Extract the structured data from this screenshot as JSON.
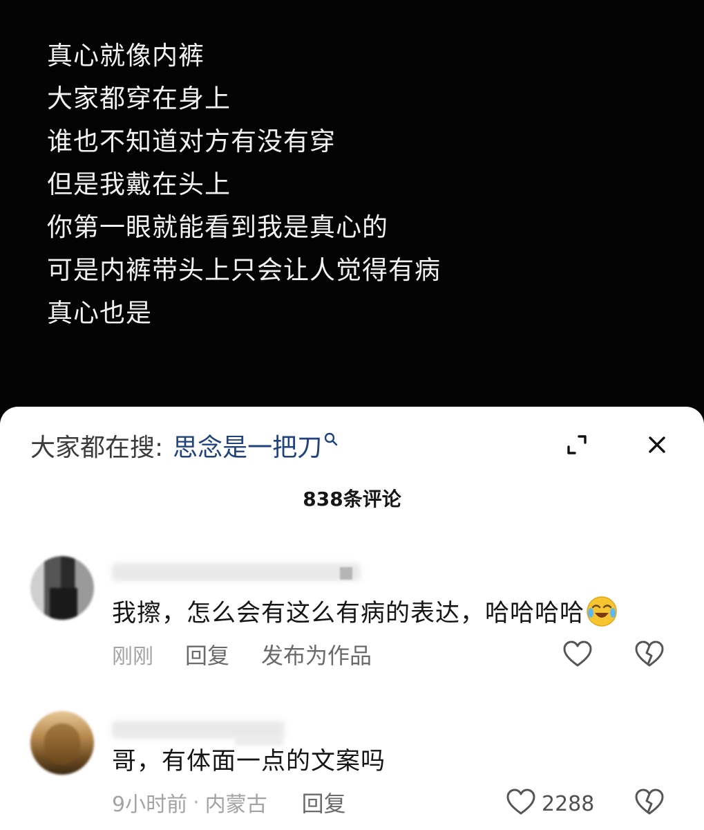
{
  "caption": {
    "lines": [
      "真心就像内裤",
      "大家都穿在身上",
      "谁也不知道对方有没有穿",
      "但是我戴在头上",
      "你第一眼就能看到我是真心的",
      "可是内裤带头上只会让人觉得有病",
      "真心也是"
    ]
  },
  "search": {
    "prefix": "大家都在搜:",
    "term": "思念是一把刀",
    "icon": "search-icon",
    "term_color": "#20437f"
  },
  "header": {
    "expand_icon": "expand-icon",
    "close_icon": "close-icon",
    "comment_count": "838条评论"
  },
  "comments": [
    {
      "text": "我擦，怎么会有这么有病的表达，哈哈哈哈",
      "emoji": "laughing-crying-emoji",
      "time": "刚刚",
      "reply_label": "回复",
      "publish_label": "发布为作品",
      "like_icon": "heart-icon",
      "dislike_icon": "broken-heart-icon"
    },
    {
      "text": "哥，有体面一点的文案吗",
      "time": "9小时前",
      "separator": "·",
      "location": "内蒙古",
      "reply_label": "回复",
      "like_count": "2288",
      "like_icon": "heart-icon",
      "dislike_icon": "broken-heart-icon"
    }
  ],
  "colors": {
    "video_background": "#030303",
    "sheet_background": "#ffffff",
    "caption_text": "#f2f2f2",
    "meta_text": "#a3a3a3"
  }
}
